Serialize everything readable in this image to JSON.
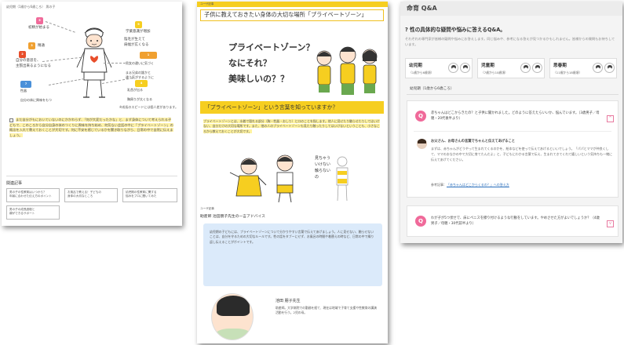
{
  "left": {
    "breadcrumb": "幼児期（1歳から6歳ころ） 男の子",
    "labels": [
      {
        "num": "5",
        "text": "初精が始まる",
        "color": "#f06a9a"
      },
      {
        "num": "9",
        "text": "学業意識が増加",
        "color": "#f6ce20"
      },
      {
        "num": "8",
        "text": "陰毛が生えて\n肩幅が広くなる",
        "color": "#8bc34a"
      },
      {
        "num": "3",
        "text": "精通",
        "color": "#f0a030"
      },
      {
        "num": "2",
        "text": "自分の意思を、\n主張出来るようになる",
        "color": "#e84e2b"
      },
      {
        "num": "1",
        "text": "男女の違いに気づく\n\nまぁ兄弟の誰かと\n違う気がするように",
        "color": "#f0a030"
      },
      {
        "num": "4",
        "text": "乳首が出る\n\n胸周りが太くなる",
        "color": "#f6ce20"
      },
      {
        "num": "7",
        "text": "性器\n\n自分の体に興味をもつ",
        "color": "#4a90d9"
      }
    ],
    "footnote": "※成長のスピードには個人差があります。",
    "check_text": "まだ自分がもにおいていないのにかかわらず、「何が大変だったかな」と、まず身体について考えられる子どもで、このころから自分自身の体のつくりに興味を持ち始め、何気ない会話の中に「プライベートゾーン」の概念を入れて教えておくことが大切です。何に不安を感じているかを聞き取りながら、日常の中で自然に伝えましょう。",
    "related_title": "関連記事",
    "related": [
      "男の子の性教育はいつから？\n年齢に合わせた伝え方のポイント",
      "お風呂で教える！子どもの\n身体の大切なところ",
      "幼児期の性教育に関する\n悩みをプロに聞いてみた",
      "男の子の成長過程と\n親ができるサポート"
    ]
  },
  "mid": {
    "tag": "ユーザ記事",
    "title": "子供に教えておきたい身体の大切な場所「プライベートゾーン」",
    "hand_title": [
      "プライベートゾーン？",
      "なにそれ？",
      "美味しいの？？"
    ],
    "question": "「プライベートゾーン」という言葉を知っていますか？",
    "body": "プライベートゾーンとは、水着で隠れる部分（胸・性器・おしり）と口のことを指します。他人に見せたり触らせたりしてはいけない、自分だけの大切な場所です。また、他の人のプライベートゾーンも見たり触ったりしてはいけないということも、小さなころから教えておくことが大切です。",
    "side_caption": "見ちゃう\nいけない\n触らない\nの",
    "advice_tag": "ユーザ記事",
    "advice_title": "助産師 池田朋子先生の一言アドバイス",
    "advice_body": "幼児期の子どもには、プライベートゾーンについて分かりやすい言葉で伝えてあげましょう。人に見せない、触らせないことは、自分を守るための大切なルールです。性の話をタブーにせず、お風呂の時間や着替えの時など、日常の中で繰り返し伝えることがポイントです。",
    "prof_name": "池田 朋子先生",
    "prof_bio": "助産師。大学病院での勤務を経て、現在は地域で子育て支援や性教育の講演活動を行う。2児の母。"
  },
  "right": {
    "header": "命育 Q&A",
    "heading": "性の具体的な疑問や悩みに答えるQ&A。",
    "desc": "それぞれの専門家が皆様の疑問や悩みにお答えします。同じ悩みや、参考になる答えが見つかるかもしれません。皆様からの質問もお待ちしています。",
    "cards": [
      {
        "title": "幼児期",
        "sub": "（1歳から6歳頃）"
      },
      {
        "title": "児童期",
        "sub": "（7歳から10歳頃）"
      },
      {
        "title": "思春期",
        "sub": "（11歳から18歳頃）"
      }
    ],
    "section_label": "幼児期（1歳から6歳ころ）",
    "qa1": {
      "q": "赤ちゃんはどこからきたの？と子供に聞かれました。どのように答えたらいいか、悩んでいます。（3歳男子／母親・20代後半より）",
      "a_title": "お父さん、お母さんの言葉でちゃんと伝えてあげること",
      "a_body": "まずは、赤ちゃんがどうやって生まれてくるのかを、絵本などを使って伝えてあげるといいでしょう。「パパとママが仲良くして、ママのおなかの中で大切に育てたんだよ」と、子どもにわかる言葉で伝え、生まれてきてくれて嬉しいという気持ちも一緒に伝えてあげてください。",
      "ref_prefix": "参考記事：",
      "ref_link": "「赤ちゃんはどこからくるの？」への答え方"
    },
    "qa2": {
      "q": "わが子が5つ伏せで、床にペニスを擦り付けるような行動をしています。やめさせた方がよいでしょうか？（4歳男子／母親・30代前半より）"
    }
  }
}
